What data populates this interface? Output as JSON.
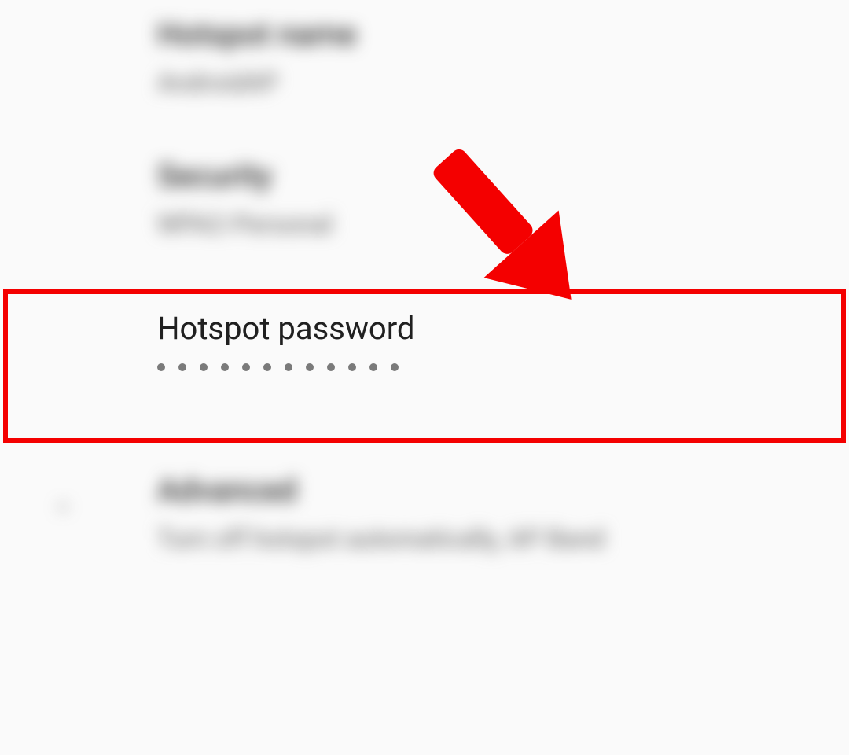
{
  "rows": {
    "hotspot_name": {
      "title": "Hotspot name",
      "value": "AndroidAP"
    },
    "security": {
      "title": "Security",
      "value": "WPA2-Personal"
    },
    "password": {
      "title": "Hotspot password",
      "dot_count": 12
    },
    "advanced": {
      "title": "Advanced",
      "value": "Turn off hotspot automatically, AP Band"
    }
  },
  "annotation": {
    "highlight_color": "#f40000"
  }
}
